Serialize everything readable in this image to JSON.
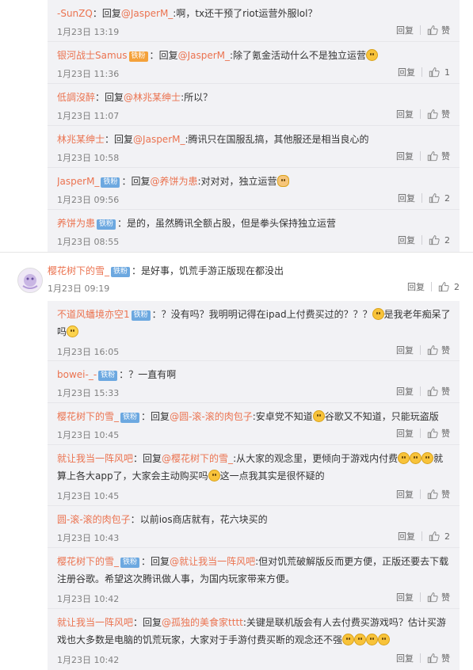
{
  "labels": {
    "reply": "回复",
    "like": "赞",
    "badge_fan": "铁粉"
  },
  "thread1": [
    {
      "user": "-SunZQ",
      "sep": "：",
      "prefix": "回复",
      "mention": "@JasperM_",
      "text": ":啊，tx还干预了riot运营外服lol？",
      "time": "1月23日 13:19",
      "likes": "赞"
    },
    {
      "user": "银河战士Samus",
      "gold_badge": "铁粉",
      "sep": "：",
      "prefix": "回复",
      "mention": "@JasperM_",
      "text": ":除了氪金活动什么不是独立运营",
      "emoji": "grin-emoji",
      "time": "1月23日 11:36",
      "likes": "1"
    },
    {
      "user": "低調沒醉",
      "sep": "：",
      "prefix": "回复",
      "mention": "@林兆某绅士",
      "text": ":所以？",
      "time": "1月23日 11:07",
      "likes": "赞"
    },
    {
      "user": "林兆某绅士",
      "sep": "：",
      "prefix": "回复",
      "mention": "@JasperM_",
      "text": ":腾讯只在国服乱搞，其他服还是相当良心的",
      "time": "1月23日 10:58",
      "likes": "赞"
    },
    {
      "user": "JasperM_",
      "badge": "铁粉",
      "sep": "：",
      "prefix": "回复",
      "mention": "@养饼为患",
      "text": ":对对对，独立运营",
      "emoji": "doge-emoji",
      "time": "1月23日 09:56",
      "likes": "2"
    },
    {
      "user": "养饼为患",
      "badge": "铁粉",
      "sep": "：",
      "text": "是的，虽然腾讯全额占股，但是拳头保持独立运营",
      "time": "1月23日 08:55",
      "likes": "2"
    }
  ],
  "top_comment": {
    "user": "樱花树下的雪_",
    "badge": "铁粉",
    "sep": "：",
    "text": "是好事，饥荒手游正版现在都没出",
    "time": "1月23日 09:19",
    "likes": "2"
  },
  "thread2": [
    {
      "user": "不道风蟠境亦空1",
      "badge": "铁粉",
      "sep": "：",
      "text_a": "？没有吗？我明明记得在ipad上付费买过的？？？",
      "text_b": "是我老年痴呆了吗",
      "time": "1月23日 16:05",
      "likes": "赞"
    },
    {
      "user": "bowei-_-",
      "badge": "铁粉",
      "sep": "：",
      "text": "？一直有啊",
      "time": "1月23日 15:33",
      "likes": "赞"
    },
    {
      "user": "樱花树下的雪_",
      "badge": "铁粉",
      "sep": "：",
      "prefix": "回复",
      "mention": "@圆-滚-滚的肉包子",
      "text_a": ":安卓党不知道",
      "text_b": "谷歌又不知道，只能玩盗版",
      "time": "1月23日 10:45",
      "likes": "赞"
    },
    {
      "user": "就让我当一阵风吧",
      "sep": "：",
      "prefix": "回复",
      "mention": "@樱花树下的雪_",
      "text_a": ":从大家的观念里，更倾向于游戏内付费",
      "text_b": "就算上各大app了，大家会主动购买吗",
      "text_c": "这一点我其实是很怀疑的",
      "time": "1月23日 10:45",
      "likes": "赞"
    },
    {
      "user": "圆-滚-滚的肉包子",
      "sep": "：",
      "text": "以前ios商店就有，花六块买的",
      "time": "1月23日 10:43",
      "likes": "2"
    },
    {
      "user": "樱花树下的雪_",
      "badge": "铁粉",
      "sep": "：",
      "prefix": "回复",
      "mention": "@就让我当一阵风吧",
      "text": ":但对饥荒破解版反而更方便，正版还要去下载注册谷歌。希望这次腾讯做人事，为国内玩家带来方便。",
      "time": "1月23日 10:42",
      "likes": "赞"
    },
    {
      "user": "就让我当一阵风吧",
      "sep": "：",
      "prefix": "回复",
      "mention": "@孤独的美食家tttt",
      "text": ":关键是联机版会有人去付费买游戏吗？估计买游戏也大多数是电脑的饥荒玩家，大家对于手游付费买断的观念还不强",
      "time": "1月23日 10:42",
      "likes": "赞"
    }
  ]
}
